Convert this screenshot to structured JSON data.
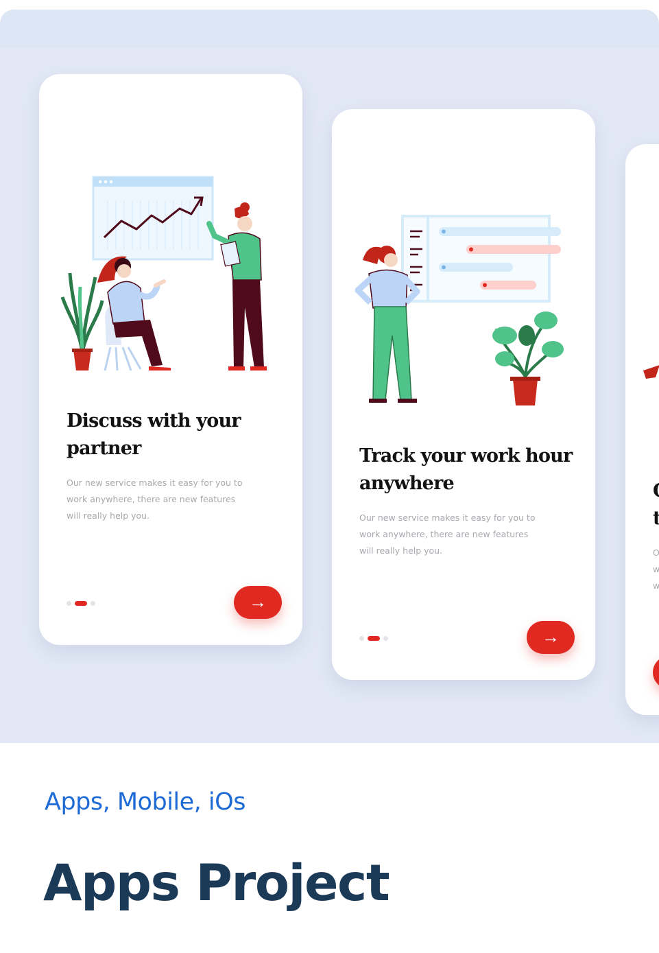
{
  "cards": [
    {
      "title_line1": "Discuss with your",
      "title_line2": "partner",
      "desc_line1": "Our new service makes it easy for you to",
      "desc_line2": "work anywhere, there are new features",
      "desc_line3": "will really help you.",
      "next_arrow": "→",
      "active_page": 2,
      "page_count": 3
    },
    {
      "title_line1": "Track your work hour",
      "title_line2": "anywhere",
      "desc_line1": "Our new service makes it easy for you to",
      "desc_line2": "work anywhere, there are new features",
      "desc_line3": "will really help you.",
      "next_arrow": "→",
      "active_page": 2,
      "page_count": 3
    },
    {
      "title_line1": "C",
      "title_line2": "t",
      "desc_line1": "O",
      "desc_line2": "w",
      "desc_line3": "w"
    }
  ],
  "project": {
    "tags": "Apps, Mobile, iOs",
    "title": "Apps Project"
  },
  "colors": {
    "accent_red": "#e02a21",
    "tag_blue": "#1e6bd6",
    "title_navy": "#1b3a57",
    "preview_bg": "#e2e8f5"
  }
}
